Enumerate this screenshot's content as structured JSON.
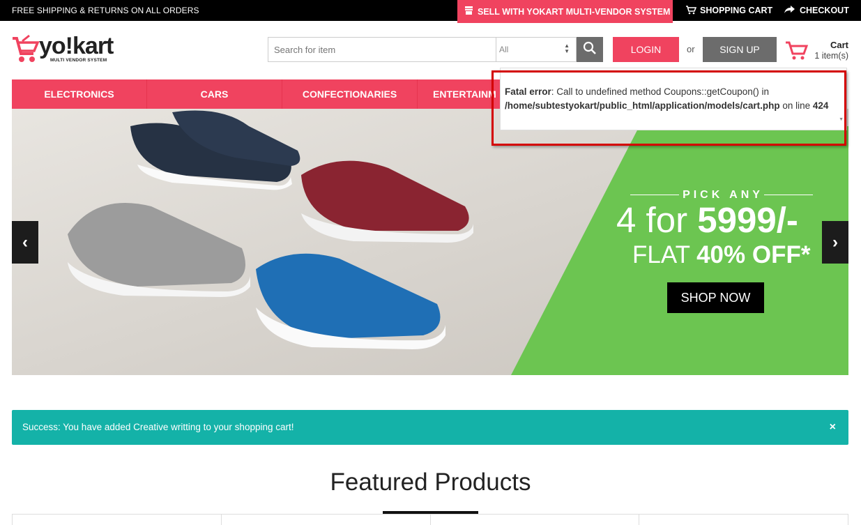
{
  "topbar": {
    "promo": "FREE SHIPPING & RETURNS ON ALL ORDERS",
    "sell_label": "SELL WITH YOKART MULTI-VENDOR SYSTEM",
    "cart_label": "SHOPPING CART",
    "checkout_label": "CHECKOUT"
  },
  "logo": {
    "brand": "yo!kart",
    "tagline": "MULTI VENDOR SYSTEM"
  },
  "search": {
    "placeholder": "Search for item",
    "category": "All"
  },
  "auth": {
    "login_label": "LOGIN",
    "or_label": "or",
    "signup_label": "SIGN UP"
  },
  "cart": {
    "title": "Cart",
    "count": "1 item(s)"
  },
  "nav": {
    "items": [
      "ELECTRONICS",
      "CARS",
      "CONFECTIONARIES",
      "ENTERTAINM"
    ]
  },
  "banner": {
    "pick": "PICK ANY",
    "offer_prefix": "4 for ",
    "offer_price": "5999/-",
    "flat_prefix": "FLAT ",
    "flat_value": "40% OFF*",
    "cta": "SHOP NOW",
    "prev": "‹",
    "next": "›"
  },
  "error": {
    "label": "Fatal error",
    "message": ": Call to undefined method Coupons::getCoupon() in ",
    "path": "/home/subtestyokart/public_html/application/models/cart.php",
    "on_line": " on line ",
    "line": "424"
  },
  "alert": {
    "message": "Success: You have added Creative writting to your shopping cart!",
    "close": "×"
  },
  "featured": {
    "title": "Featured Products"
  },
  "colors": {
    "brand": "#f0435f",
    "success": "#14b2a8",
    "banner_green": "#6cc551",
    "error_frame": "#d40000"
  }
}
